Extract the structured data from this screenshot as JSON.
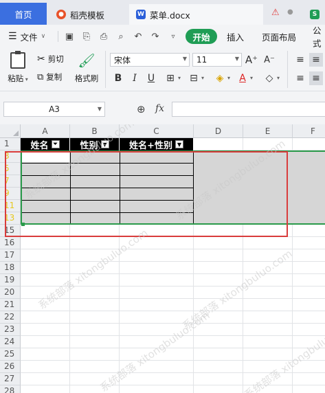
{
  "tabs": {
    "home": "首页",
    "template": "稻壳模板",
    "document": "菜单.docx",
    "doc_badge": "W",
    "green_badge": "S",
    "warn_icon": "warning-icon"
  },
  "menu": {
    "file": "文件",
    "start": "开始",
    "insert": "插入",
    "page_layout": "页面布局",
    "formula": "公式"
  },
  "ribbon": {
    "paste": "粘贴",
    "cut": "剪切",
    "copy": "复制",
    "format_painter": "格式刷",
    "font_name": "宋体",
    "font_size": "11",
    "grow_font": "A⁺",
    "shrink_font": "A⁻",
    "bold": "B",
    "italic": "I",
    "underline": "U",
    "font_color_letter": "A"
  },
  "formula_bar": {
    "cell_ref": "A3",
    "fx": "fx",
    "zoom_icon": "⊕"
  },
  "sheet": {
    "columns": [
      "A",
      "B",
      "C",
      "D",
      "E",
      "F"
    ],
    "rows": [
      "1",
      "3",
      "5",
      "7",
      "9",
      "11",
      "13",
      "15",
      "16",
      "17",
      "18",
      "19",
      "20",
      "21",
      "22",
      "23",
      "24",
      "25",
      "26",
      "27",
      "28"
    ],
    "highlighted_rows": [
      "3",
      "5",
      "7",
      "9",
      "11",
      "13"
    ],
    "header": [
      "姓名",
      "性别",
      "姓名+性别"
    ],
    "accent_selection": "#2a9a4a",
    "annotation_box_color": "#d93c3c"
  },
  "watermark": "系统部落 xitongbuluo.com"
}
